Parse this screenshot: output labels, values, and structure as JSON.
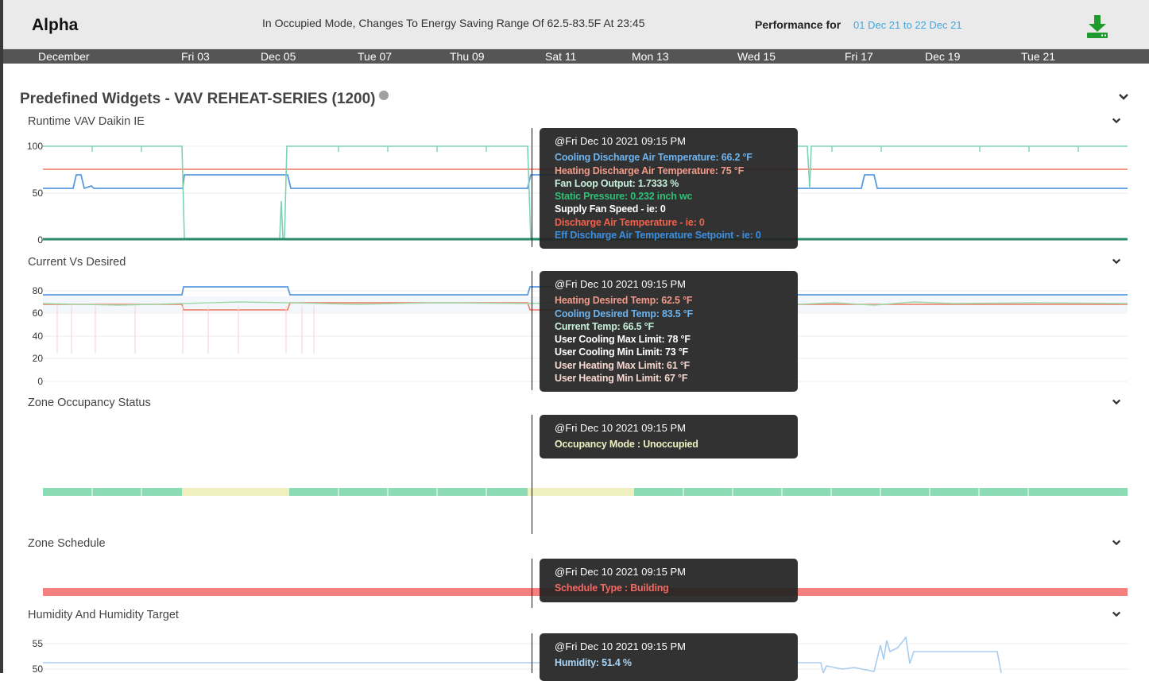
{
  "header": {
    "zone_name": "Alpha",
    "status_message": "In Occupied Mode, Changes To Energy Saving Range Of 62.5-83.5F At 23:45",
    "performance_label": "Performance for",
    "date_range": "01 Dec 21 to 22 Dec 21",
    "download_icon": "download-icon",
    "download_color": "#1e9b2c"
  },
  "timeline": {
    "ticks": [
      "December",
      "Fri 03",
      "Dec 05",
      "Tue 07",
      "Thu 09",
      "Sat 11",
      "Mon 13",
      "Wed 15",
      "Fri 17",
      "Dec 19",
      "Tue 21"
    ]
  },
  "section": {
    "title": "Predefined Widgets - VAV REHEAT-SERIES (1200)",
    "collapse_icon": "chevron-down-icon"
  },
  "widgets": [
    {
      "title": "Runtime VAV Daikin IE",
      "y_ticks": [
        "100",
        "50",
        "0"
      ],
      "tooltip": {
        "header": "@Fri Dec 10 2021 09:15 PM",
        "lines": [
          {
            "text": "Cooling Discharge Air Temperature: 66.2 °F",
            "color": "#6cb4f0"
          },
          {
            "text": "Heating Discharge Air Temperature: 75 °F",
            "color": "#f29a8a"
          },
          {
            "text": "Fan Loop Output: 1.7333 %",
            "color": "#c7f0dc"
          },
          {
            "text": "Static Pressure: 0.232 inch wc",
            "color": "#2fbf76"
          },
          {
            "text": "Supply Fan Speed - ie: 0",
            "color": "#ffffff"
          },
          {
            "text": "Discharge Air Temperature - ie: 0",
            "color": "#f0604a"
          },
          {
            "text": "Eff Discharge Air Temperature Setpoint - ie: 0",
            "color": "#3a8ee0"
          }
        ]
      }
    },
    {
      "title": "Current Vs Desired",
      "y_ticks": [
        "80",
        "60",
        "40",
        "20",
        "0"
      ],
      "tooltip": {
        "header": "@Fri Dec 10 2021 09:15 PM",
        "lines": [
          {
            "text": "Heating Desired Temp: 62.5 °F",
            "color": "#f29a8a"
          },
          {
            "text": "Cooling Desired Temp: 83.5 °F",
            "color": "#6cb4f0"
          },
          {
            "text": "Current Temp: 66.5 °F",
            "color": "#c7f0dc"
          },
          {
            "text": "User Cooling Max Limit: 78 °F",
            "color": "#ffffff"
          },
          {
            "text": "User Cooling Min Limit: 73 °F",
            "color": "#ffffff"
          },
          {
            "text": "User Heating Max Limit: 61 °F",
            "color": "#f7d7cf"
          },
          {
            "text": "User Heating Min Limit: 67 °F",
            "color": "#f7d7cf"
          }
        ]
      }
    },
    {
      "title": "Zone Occupancy Status",
      "tooltip": {
        "header": "@Fri Dec 10 2021 09:15 PM",
        "lines": [
          {
            "text": "Occupancy Mode : Unoccupied",
            "color": "#eef0c2"
          }
        ]
      }
    },
    {
      "title": "Zone Schedule",
      "tooltip": {
        "header": "@Fri Dec 10 2021 09:15 PM",
        "lines": [
          {
            "text": "Schedule Type : Building",
            "color": "#f06a62"
          }
        ]
      }
    },
    {
      "title": "Humidity And Humidity Target",
      "y_ticks": [
        "55",
        "50"
      ],
      "tooltip": {
        "header": "@Fri Dec 10 2021 09:15 PM",
        "lines": [
          {
            "text": "Humidity: 51.4 %",
            "color": "#a8d4f5"
          }
        ]
      }
    }
  ],
  "colors": {
    "fan_loop": "#7dd3b1",
    "cooling_dat": "#5a9be0",
    "heating_dat": "#f07860",
    "static": "#2b8a6a",
    "occupied": "#f0efbf",
    "unoccupied": "#8bdcb5",
    "schedule": "#f47f7f",
    "humidity": "#a8cdf0"
  }
}
